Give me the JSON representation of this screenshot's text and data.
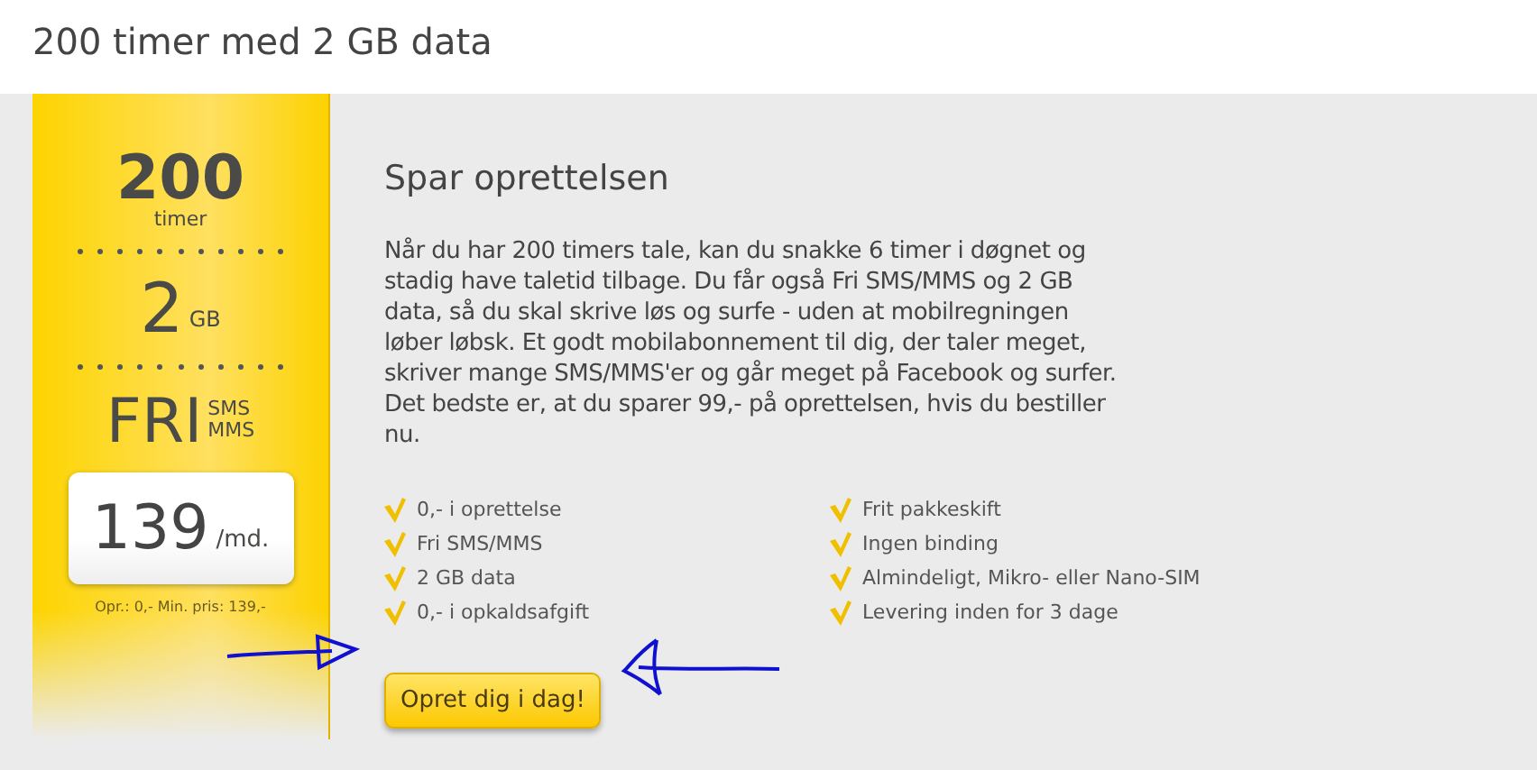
{
  "title": "200 timer med 2 GB data",
  "summary": {
    "minutes": "200",
    "minutes_unit": "timer",
    "data": "2",
    "data_unit": "GB",
    "free": "FRI",
    "free_units": [
      "SMS",
      "MMS"
    ],
    "price": "139",
    "price_unit": "/md.",
    "price_note": "Opr.: 0,- Min. pris: 139,-"
  },
  "offer": {
    "heading": "Spar oprettelsen",
    "description": "Når du har 200 timers tale, kan du snakke 6 timer i døgnet og stadig have taletid tilbage. Du får også Fri SMS/MMS og 2 GB data, så du skal skrive løs og surfe - uden at mobilregningen løber løbsk. Et godt mobilabonnement til dig, der taler meget, skriver mange SMS/MMS'er og går meget på Facebook og surfer. Det bedste er, at du sparer 99,- på oprettelsen, hvis du bestiller nu.",
    "features": [
      [
        "0,- i oprettelse",
        "Fri SMS/MMS",
        "2 GB data",
        "0,- i opkaldsafgift"
      ],
      [
        "Frit pakkeskift",
        "Ingen binding",
        "Almindeligt, Mikro- eller Nano-SIM",
        "Levering inden for 3 dage"
      ]
    ],
    "button": "Opret dig i dag!"
  }
}
